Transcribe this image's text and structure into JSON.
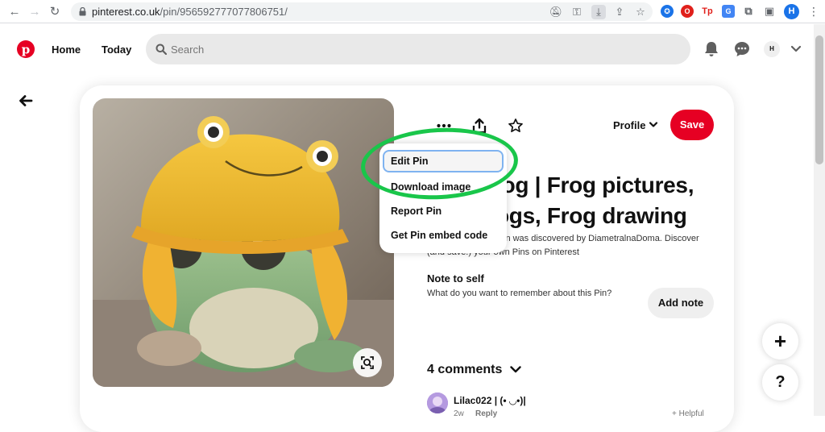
{
  "browser": {
    "url_host": "pinterest.co.uk",
    "url_path": "/pin/956592777077806751/",
    "profile_initial": "H",
    "extensions": [
      {
        "name": "extension-blue-icon",
        "color": "#1a73e8",
        "glyph": "✪"
      },
      {
        "name": "opera-icon",
        "color": "#e0201b",
        "glyph": "O"
      },
      {
        "name": "tp-extension-icon",
        "color": "#e0201b",
        "glyph": "Tp"
      },
      {
        "name": "translate-extension-icon",
        "color": "#4285f4",
        "glyph": "G"
      }
    ]
  },
  "header": {
    "home": "Home",
    "today": "Today",
    "search_placeholder": "Search",
    "avatar_initial": "H"
  },
  "pin": {
    "profile_label": "Profile",
    "save_label": "Save",
    "title_line1": "rog | Frog pictures,",
    "title_line2": "ogs, Frog drawing",
    "description_line1": "in was discovered by DiametralnaDoma. Discover",
    "description_line2": "(and save!) your own Pins on Pinterest",
    "note_title": "Note to self",
    "note_text": "What do you want to remember about this Pin?",
    "add_note_label": "Add note",
    "comments_title": "4 comments",
    "comment": {
      "author": "Lilac022 | (• ◡•)|",
      "age": "2w",
      "reply": "Reply",
      "helpful": "+ Helpful"
    }
  },
  "menu": {
    "items": [
      {
        "label": "Edit Pin",
        "focused": true
      },
      {
        "label": "Download image",
        "focused": false
      },
      {
        "label": "Report Pin",
        "focused": false
      },
      {
        "label": "Get Pin embed code",
        "focused": false
      }
    ]
  },
  "fab": {
    "plus": "+",
    "help": "?"
  },
  "colors": {
    "brand_red": "#e60023",
    "annotation_green": "#19c64a",
    "focus_outline": "#7fb3f0"
  }
}
